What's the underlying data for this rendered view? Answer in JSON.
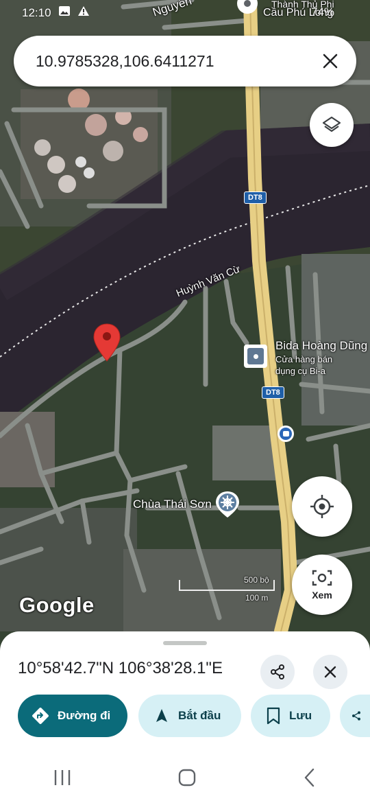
{
  "status": {
    "time": "12:10",
    "battery": "74%",
    "icons": [
      "image-icon",
      "warning-icon"
    ]
  },
  "search": {
    "query": "10.9785328,106.6411271"
  },
  "map": {
    "labels": {
      "road_top": "Nguyễn",
      "place_top": "Cầu Phú Long",
      "place_top_small": "Thành Thủ Phi",
      "road_huynh": "Huỳnh Văn Cừ",
      "shield1": "DT8",
      "shield2": "DT8",
      "poi_bida_title": "Bida Hoàng Dũng",
      "poi_bida_sub1": "Cửa hàng bán",
      "poi_bida_sub2": "dụng cụ Bi-a",
      "poi_chua": "Chùa Thái Sơn",
      "scale_top": "500 bộ",
      "scale_bottom": "100 m",
      "google": "Google"
    }
  },
  "view_button": {
    "label": "Xem"
  },
  "sheet": {
    "coords": "10°58'42.7\"N 106°38'28.1\"E",
    "chips": [
      {
        "label": "Đường đi",
        "icon": "directions-icon"
      },
      {
        "label": "Bắt đầu",
        "icon": "navigation-arrow-icon"
      },
      {
        "label": "Lưu",
        "icon": "bookmark-icon"
      },
      {
        "label": "",
        "icon": "share-icon"
      }
    ]
  },
  "colors": {
    "primary": "#0b6b7a",
    "secondary": "#d6f0f5",
    "pin": "#e53935",
    "river": "#2b2530",
    "road_main": "#e7cf85"
  }
}
